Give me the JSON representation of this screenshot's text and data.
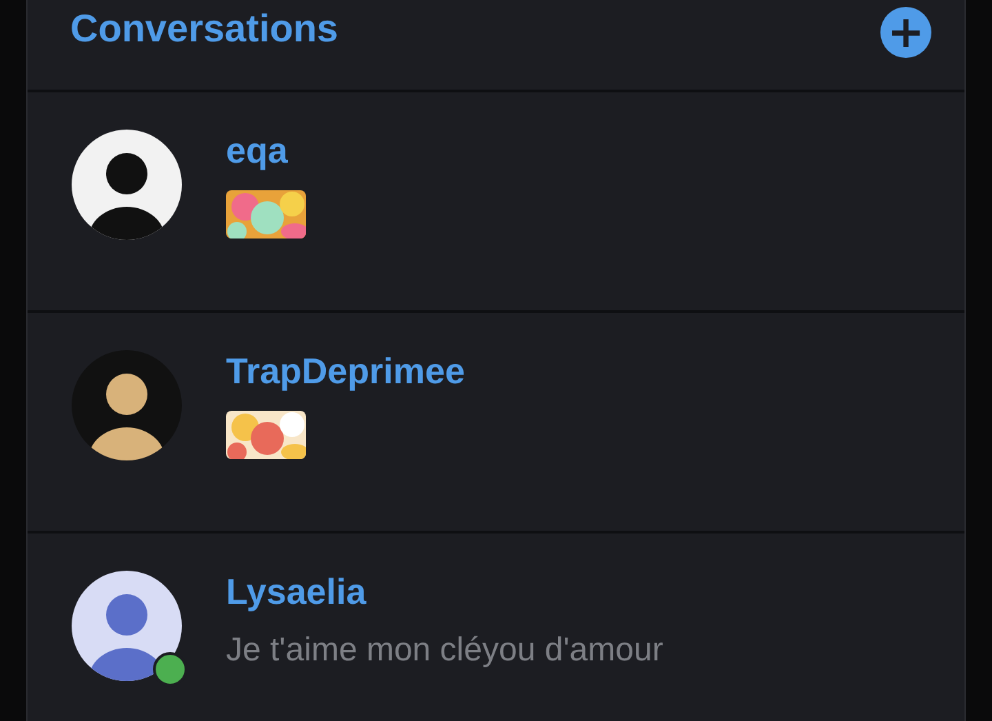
{
  "header": {
    "title": "Conversations",
    "add_button": "+"
  },
  "conversations": [
    {
      "name": "eqa",
      "online": false,
      "message": {
        "kind": "sticker"
      }
    },
    {
      "name": "TrapDeprimee",
      "online": false,
      "message": {
        "kind": "sticker"
      }
    },
    {
      "name": "Lysaelia",
      "online": true,
      "message": {
        "kind": "text",
        "text": "Je t'aime mon cléyou d'amour"
      }
    }
  ]
}
